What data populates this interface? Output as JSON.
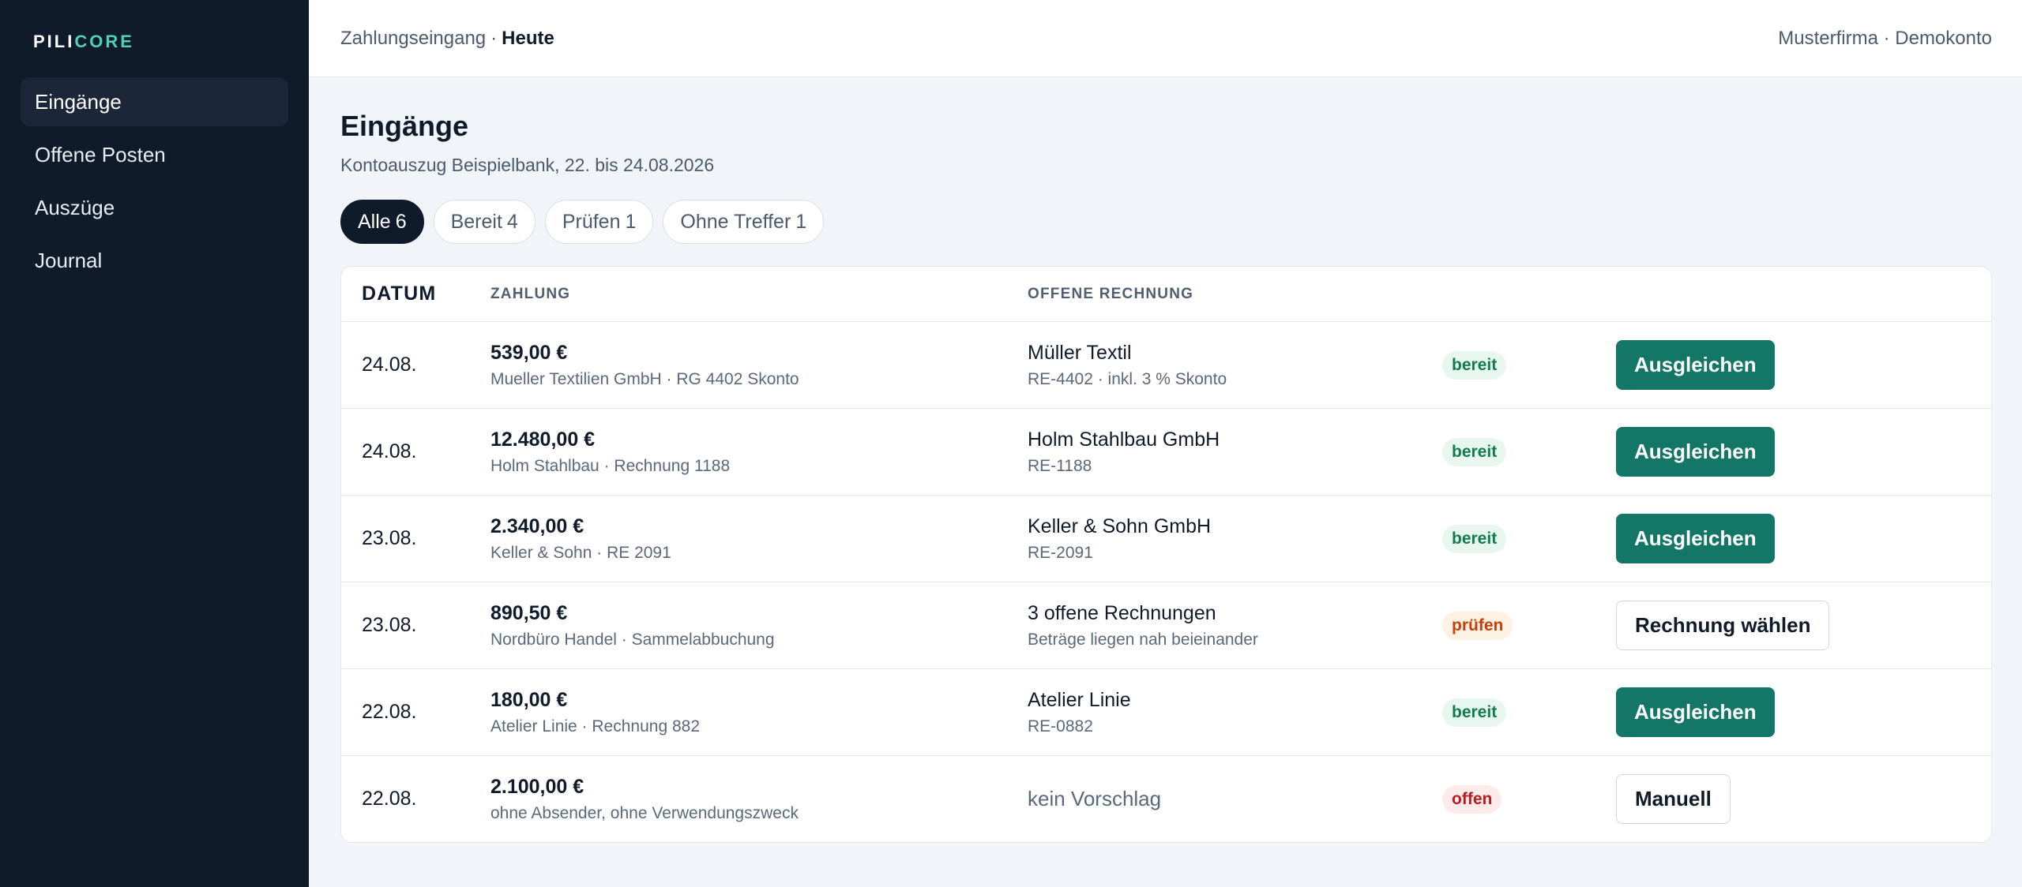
{
  "app": {
    "logo_part1": "PILI",
    "logo_part2": "CORE",
    "brand_accent": "#4fd1b5"
  },
  "sidebar": {
    "items": [
      {
        "label": "Eingänge",
        "active": true
      },
      {
        "label": "Offene Posten",
        "active": false
      },
      {
        "label": "Auszüge",
        "active": false
      },
      {
        "label": "Journal",
        "active": false
      }
    ]
  },
  "header": {
    "breadcrumb_parent": "Zahlungseingang",
    "breadcrumb_separator": "·",
    "breadcrumb_current": "Heute",
    "account": "Musterfirma · Demokonto"
  },
  "page": {
    "title": "Eingänge",
    "subtitle": "Kontoauszug Beispielbank, 22. bis 24.08.2026"
  },
  "filters": [
    {
      "label": "Alle",
      "count": "6",
      "active": true
    },
    {
      "label": "Bereit",
      "count": "4",
      "active": false
    },
    {
      "label": "Prüfen",
      "count": "1",
      "active": false
    },
    {
      "label": "Ohne Treffer",
      "count": "1",
      "active": false
    }
  ],
  "table": {
    "headers": {
      "date": "DATUM",
      "payment": "ZAHLUNG",
      "invoice": "OFFENE RECHNUNG"
    },
    "rows": [
      {
        "date": "24.08.",
        "amount": "539,00 €",
        "payer": "Mueller Textilien GmbH · RG 4402 Skonto",
        "invoice_name": "Müller Textil",
        "invoice_detail": "RE-4402 · inkl. 3 % Skonto",
        "status": "bereit",
        "action": "Ausgleichen"
      },
      {
        "date": "24.08.",
        "amount": "12.480,00 €",
        "payer": "Holm Stahlbau · Rechnung 1188",
        "invoice_name": "Holm Stahlbau GmbH",
        "invoice_detail": "RE-1188",
        "status": "bereit",
        "action": "Ausgleichen"
      },
      {
        "date": "23.08.",
        "amount": "2.340,00 €",
        "payer": "Keller & Sohn · RE 2091",
        "invoice_name": "Keller & Sohn GmbH",
        "invoice_detail": "RE-2091",
        "status": "bereit",
        "action": "Ausgleichen"
      },
      {
        "date": "23.08.",
        "amount": "890,50 €",
        "payer": "Nordbüro Handel · Sammelabbuchung",
        "invoice_name": "3 offene Rechnungen",
        "invoice_detail": "Beträge liegen nah beieinander",
        "status": "prüfen",
        "action": "Rechnung wählen"
      },
      {
        "date": "22.08.",
        "amount": "180,00 €",
        "payer": "Atelier Linie · Rechnung 882",
        "invoice_name": "Atelier Linie",
        "invoice_detail": "RE-0882",
        "status": "bereit",
        "action": "Ausgleichen"
      },
      {
        "date": "22.08.",
        "amount": "2.100,00 €",
        "payer": "ohne Absender, ohne Verwendungszweck",
        "invoice_none": "kein Vorschlag",
        "status": "offen",
        "action": "Manuell"
      }
    ]
  },
  "colors": {
    "sidebar_bg": "#0f1a2b",
    "primary_button": "#137666",
    "status_ready": "#137c4f",
    "status_check": "#c2410c",
    "status_open": "#b91c1c"
  }
}
